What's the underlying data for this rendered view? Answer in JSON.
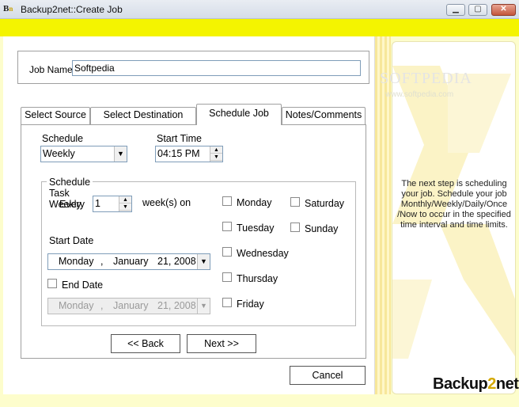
{
  "window": {
    "title": "Backup2net::Create Job",
    "icon_text_b": "B",
    "icon_text_n": "n"
  },
  "window_controls": {
    "minimize": "▁",
    "maximize": "▢",
    "close": "✕"
  },
  "job": {
    "label": "Job Name",
    "value": "Softpedia"
  },
  "tabs": [
    {
      "label": "Select Source"
    },
    {
      "label": "Select Destination"
    },
    {
      "label": "Schedule Job"
    },
    {
      "label": "Notes/Comments"
    }
  ],
  "schedule": {
    "schedule_label": "Schedule",
    "schedule_value": "Weekly",
    "start_time_label": "Start Time",
    "start_time_value": "04:15 PM",
    "frame_title": "Schedule Task Weekly",
    "every_label": "Every",
    "every_value": "1",
    "weeks_on_label": "week(s) on",
    "start_date_label": "Start Date",
    "start_date": {
      "weekday": "Monday",
      "sep": ",",
      "month": "January",
      "day_year": "21, 2008"
    },
    "end_date_label": "End Date",
    "end_date": {
      "weekday": "Monday",
      "sep": ",",
      "month": "January",
      "day_year": "21, 2008"
    },
    "days": {
      "monday": "Monday",
      "tuesday": "Tuesday",
      "wednesday": "Wednesday",
      "thursday": "Thursday",
      "friday": "Friday",
      "saturday": "Saturday",
      "sunday": "Sunday"
    }
  },
  "buttons": {
    "back": "<< Back",
    "next": "Next >>",
    "cancel": "Cancel"
  },
  "side": {
    "info": "The next step is scheduling your job. Schedule your job Monthly/Weekly/Daily/Once /Now to occur in the specified time interval and time limits.",
    "logo_a": "Backup",
    "logo_b": "2",
    "logo_c": "net"
  },
  "watermark": {
    "main": "SOFTPEDIA",
    "sub": "www.softpedia.com"
  },
  "colors": {
    "accent_yellow": "#f4f400",
    "panel_yellow": "#fdfdcc",
    "logo_gold": "#d4a800"
  }
}
